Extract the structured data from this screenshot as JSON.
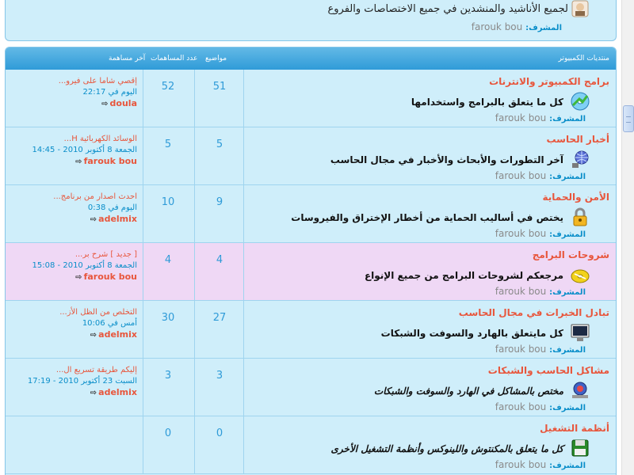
{
  "top_category": {
    "description": "لجميع الأناشيد والمنشدين في جميع الاختصاصات والفروع",
    "moderator_label": "المشرف:",
    "moderator": "farouk bou"
  },
  "forum_header": {
    "title": "منتديات الكمبيوتر",
    "topics": "مواضيع",
    "posts": "عدد المساهمات",
    "last_post": "آخر مساهمة"
  },
  "forums": [
    {
      "title": "برامج الكمبيوتر والانترنات",
      "description": "كل ما يتعلق بالبرامج واستخدامها",
      "moderator_label": "المشرف:",
      "moderator": "farouk bou",
      "topics": "51",
      "posts": "52",
      "last_title": "إقصي شاما على فيرو...",
      "last_date": "اليوم في 22:17",
      "last_user": "doula",
      "icon": "software-cd-icon"
    },
    {
      "title": "أخبار الحاسب",
      "description": "آخر التطورات والأبحاث والأخبار في مجال الحاسب",
      "moderator_label": "المشرف:",
      "moderator": "farouk bou",
      "topics": "5",
      "posts": "5",
      "last_title": "الوسائد الكهربائية H...",
      "last_date": "الجمعة 8 أكتوبر 2010 - 14:45",
      "last_user": "farouk bou",
      "icon": "network-globe-icon"
    },
    {
      "title": "الأمن والحماية",
      "description": "يختص في أساليب الحماية من أخطار الإختراق والفيروسات",
      "moderator_label": "المشرف:",
      "moderator": "farouk bou",
      "topics": "9",
      "posts": "10",
      "last_title": "احدث اصدار من برنامج...",
      "last_date": "اليوم في 0:38",
      "last_user": "adelmix",
      "icon": "lock-icon"
    },
    {
      "title": "شروحات البرامج",
      "description": "مرجعكم لشروحات البرامج من جميع الإنواع",
      "moderator_label": "المشرف:",
      "moderator": "farouk bou",
      "topics": "4",
      "posts": "4",
      "last_title": "[ جديد ] شرح بر...",
      "last_date": "الجمعة 8 أكتوبر 2010 - 15:08",
      "last_user": "farouk bou",
      "icon": "disc-icon"
    },
    {
      "title": "تبادل الخبرات في مجال الحاسب",
      "description": "كل مايتعلق بالهارد والسوفت والشبكات",
      "moderator_label": "المشرف:",
      "moderator": "farouk bou",
      "topics": "27",
      "posts": "30",
      "last_title": "التخلص من الظل الأز...",
      "last_date": "أمس في 10:06",
      "last_user": "adelmix",
      "icon": "monitor-icon"
    },
    {
      "title": "مشاكل الحاسب والشبكات",
      "description": "مختص بالمشاكل في الهارد والسوفت والشبكات",
      "moderator_label": "المشرف:",
      "moderator": "farouk bou",
      "topics": "3",
      "posts": "3",
      "last_title": "إليكم طريقة تسريع ال...",
      "last_date": "السبت 23 أكتوبر 2010 - 17:19",
      "last_user": "adelmix",
      "icon": "troubleshoot-icon"
    },
    {
      "title": "أنظمة التشغيل",
      "description": "كل ما يتعلق بالمكنتوش واللينوكس وأنظمة التشغيل الأخرى",
      "moderator_label": "المشرف:",
      "moderator": "farouk bou",
      "topics": "0",
      "posts": "0",
      "last_title": "",
      "last_date": "",
      "last_user": "",
      "icon": "floppy-disk-icon"
    }
  ]
}
